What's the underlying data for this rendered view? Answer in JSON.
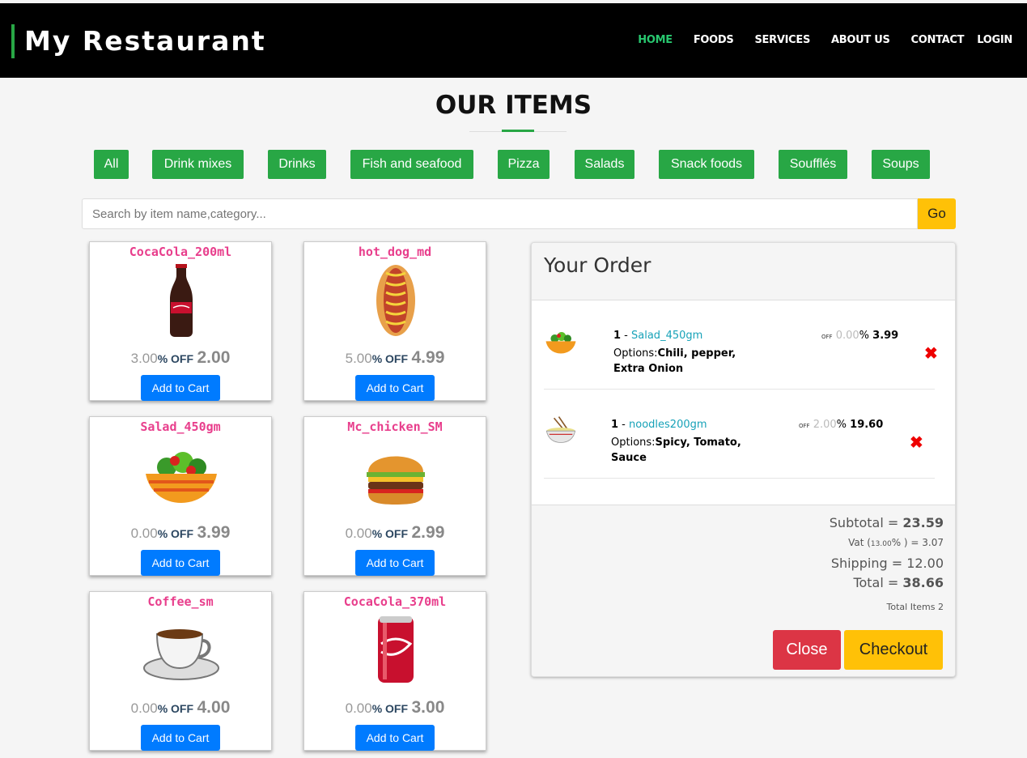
{
  "header": {
    "brand": "My Restaurant",
    "nav": [
      "HOME",
      "FOODS",
      "SERVICES",
      "ABOUT US",
      "CONTACT",
      "LOGIN"
    ],
    "active_nav": "HOME"
  },
  "section": {
    "title": "OUR ITEMS"
  },
  "categories": [
    "All",
    "Drink mixes",
    "Drinks",
    "Fish and seafood",
    "Pizza",
    "Salads",
    "Snack foods",
    "Soufflés",
    "Soups"
  ],
  "search": {
    "placeholder": "Search by item name,category...",
    "go_label": "Go"
  },
  "products": [
    {
      "name": "CocaCola_200ml",
      "discount": "3.00",
      "off_label": "% OFF",
      "price": "2.00",
      "add_label": "Add to Cart",
      "icon": "coke-bottle-icon"
    },
    {
      "name": "hot_dog_md",
      "discount": "5.00",
      "off_label": "% OFF",
      "price": "4.99",
      "add_label": "Add to Cart",
      "icon": "hot-dog-icon"
    },
    {
      "name": "Salad_450gm",
      "discount": "0.00",
      "off_label": "% OFF",
      "price": "3.99",
      "add_label": "Add to Cart",
      "icon": "salad-bowl-icon"
    },
    {
      "name": "Mc_chicken_SM",
      "discount": "0.00",
      "off_label": "% OFF",
      "price": "2.99",
      "add_label": "Add to Cart",
      "icon": "burger-icon"
    },
    {
      "name": "Coffee_sm",
      "discount": "0.00",
      "off_label": "% OFF",
      "price": "4.00",
      "add_label": "Add to Cart",
      "icon": "coffee-cup-icon"
    },
    {
      "name": "CocaCola_370ml",
      "discount": "0.00",
      "off_label": "% OFF",
      "price": "3.00",
      "add_label": "Add to Cart",
      "icon": "coke-can-icon"
    }
  ],
  "order": {
    "title": "Your Order",
    "items": [
      {
        "qty": "1",
        "sep": " - ",
        "name": "Salad_450gm",
        "options_label": "Options:",
        "options": "Chili, pepper, Extra Onion",
        "off": "OFF",
        "discount": "0.00",
        "pct": "%",
        "price": "3.99",
        "icon": "salad-bowl-icon"
      },
      {
        "qty": "1",
        "sep": " - ",
        "name": "noodles200gm",
        "options_label": "Options:",
        "options": "Spicy, Tomato, Sauce",
        "off": "OFF",
        "discount": "2.00",
        "pct": "%",
        "price": "19.60",
        "icon": "noodle-bowl-icon"
      }
    ],
    "subtotal_label": "Subtotal = ",
    "subtotal": "23.59",
    "vat_label": "Vat (",
    "vat_rate": "13.00",
    "vat_suffix": "% ) = ",
    "vat_amount": "3.07",
    "shipping_label": "Shipping = ",
    "shipping": "12.00",
    "total_label": "Total = ",
    "total": "38.66",
    "total_items_label": "Total Items ",
    "total_items": "2",
    "close_label": "Close",
    "checkout_label": "Checkout"
  },
  "colors": {
    "accent_green": "#28a745",
    "primary_blue": "#007bff",
    "warning_yellow": "#ffc107",
    "danger_red": "#dc3545",
    "product_pink": "#e83e8c"
  }
}
